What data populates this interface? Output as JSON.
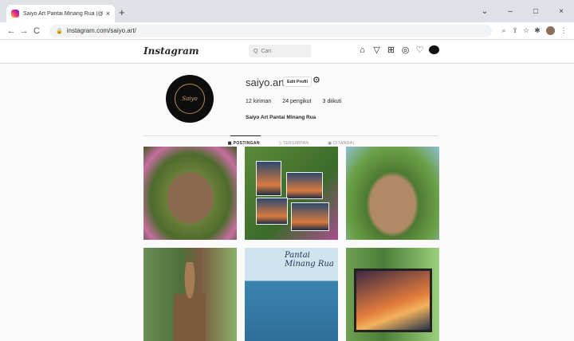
{
  "browser": {
    "tab_title": "Saiyo Art Pantai Minang Rua (@s",
    "tab_close": "×",
    "new_tab": "+",
    "url": "instagram.com/saiyo.art/",
    "back": "←",
    "forward": "→",
    "reload": "C",
    "window_controls": [
      "⌄",
      "–",
      "□",
      "×"
    ]
  },
  "header": {
    "logo": "Instagram",
    "search_placeholder": "Q  Cari"
  },
  "profile": {
    "username": "saiyo.art",
    "edit_button": "Edit Profil",
    "avatar_text": "Saiyo",
    "stats": {
      "posts": "12 kiriman",
      "followers": "24 pengikut",
      "following": "3 diikuti"
    },
    "bio_name": "Saiyo Art Pantai Minang Rua"
  },
  "tabs": {
    "posts": "▦ POSTINGAN",
    "saved": "▯ TERSIMPAN",
    "tagged": "▣ DITANDAI"
  },
  "posts": {
    "p5_text": "Pantai Minang Rua"
  },
  "colors": {
    "brand": "#262626",
    "bg": "#fafafa"
  }
}
